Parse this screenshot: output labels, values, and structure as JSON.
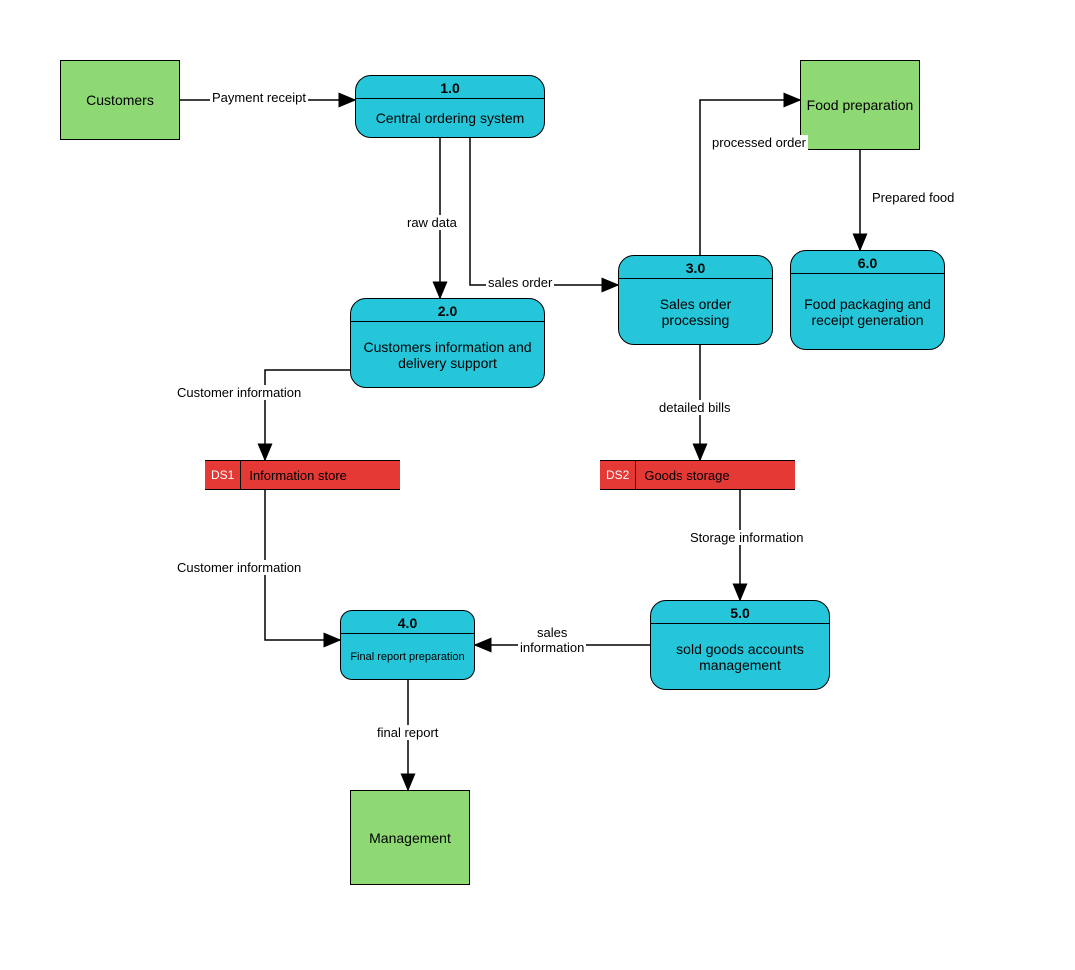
{
  "entities": {
    "customers": "Customers",
    "food_prep": "Food preparation",
    "management": "Management"
  },
  "processes": {
    "p1": {
      "num": "1.0",
      "name": "Central ordering system"
    },
    "p2": {
      "num": "2.0",
      "name": "Customers information and delivery support"
    },
    "p3": {
      "num": "3.0",
      "name": "Sales order processing"
    },
    "p4": {
      "num": "4.0",
      "name": "Final report preparation"
    },
    "p5": {
      "num": "5.0",
      "name": "sold goods accounts management"
    },
    "p6": {
      "num": "6.0",
      "name": "Food packaging and receipt generation"
    }
  },
  "datastores": {
    "ds1": {
      "id": "DS1",
      "name": "Information store"
    },
    "ds2": {
      "id": "DS2",
      "name": "Goods storage"
    }
  },
  "flows": {
    "payment_receipt": "Payment receipt",
    "raw_data": "raw data",
    "sales_order": "sales order",
    "processed_order": "processed order",
    "prepared_food": "Prepared food",
    "customer_info_1": "Customer information",
    "detailed_bills": "detailed bills",
    "storage_info": "Storage information",
    "customer_info_2": "Customer information",
    "sales_info": "sales information",
    "final_report": "final report"
  }
}
